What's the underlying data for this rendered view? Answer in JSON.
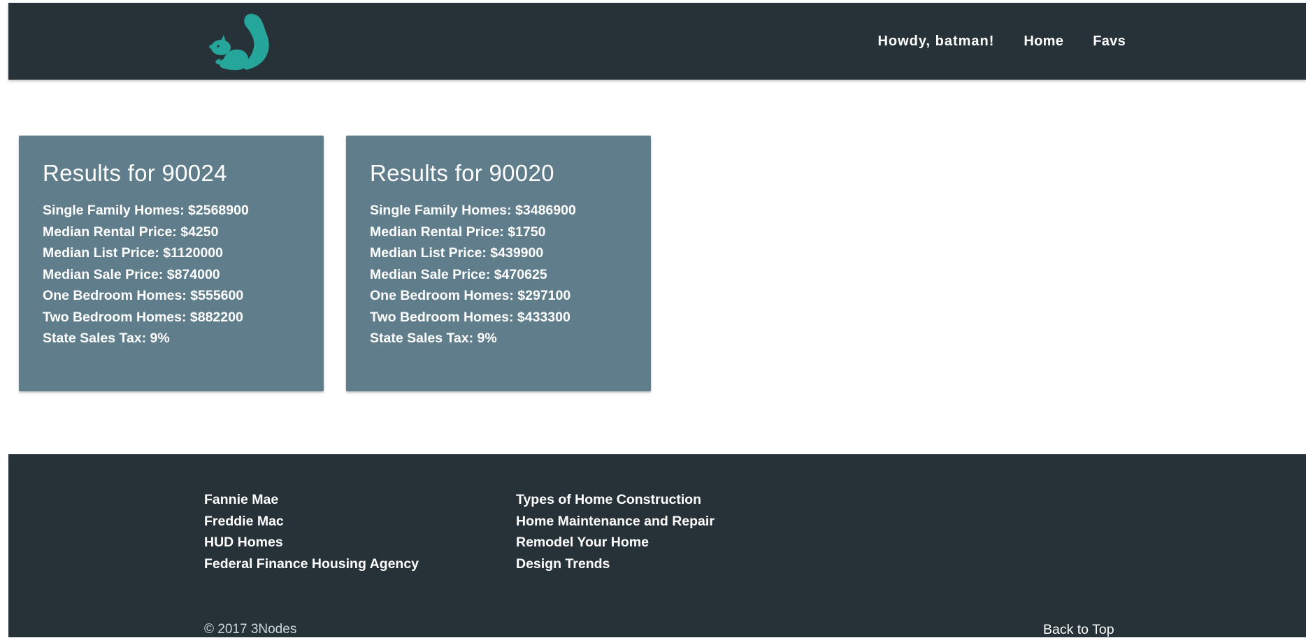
{
  "nav": {
    "logo": "squirrel-icon",
    "greeting": "Howdy, batman!",
    "home_label": "Home",
    "favs_label": "Favs"
  },
  "results": [
    {
      "title": "Results for 90024",
      "rows": [
        "Single Family Homes: $2568900",
        "Median Rental Price: $4250",
        "Median List Price: $1120000",
        "Median Sale Price: $874000",
        "One Bedroom Homes: $555600",
        "Two Bedroom Homes: $882200",
        "State Sales Tax: 9%"
      ]
    },
    {
      "title": "Results for 90020",
      "rows": [
        "Single Family Homes: $3486900",
        "Median Rental Price: $1750",
        "Median List Price: $439900",
        "Median Sale Price: $470625",
        "One Bedroom Homes: $297100",
        "Two Bedroom Homes: $433300",
        "State Sales Tax: 9%"
      ]
    }
  ],
  "footer": {
    "col1": [
      "Fannie Mae",
      "Freddie Mac",
      "HUD Homes",
      "Federal Finance Housing Agency"
    ],
    "col2": [
      "Types of Home Construction",
      "Home Maintenance and Repair",
      "Remodel Your Home",
      "Design Trends"
    ],
    "copyright": "© 2017 3Nodes",
    "back_to_top": "Back to Top"
  },
  "colors": {
    "navbar": "#263238",
    "card": "#607d8b",
    "logo": "#26a69a"
  }
}
